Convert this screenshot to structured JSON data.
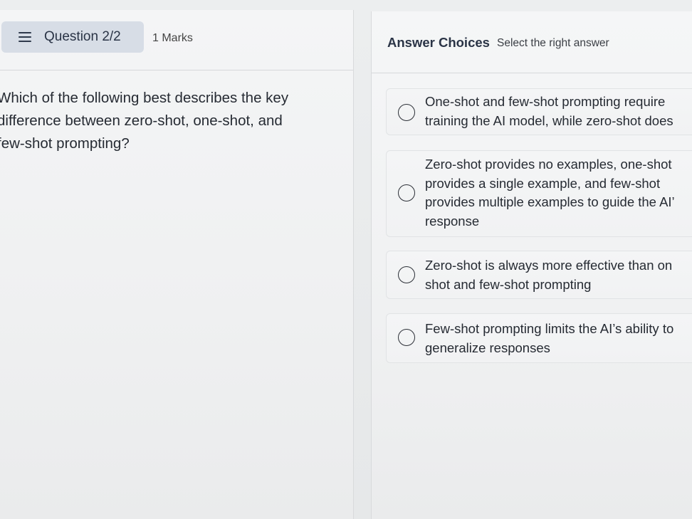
{
  "question_header": {
    "label": "Question 2/2",
    "marks": "1 Marks"
  },
  "question": {
    "lines": [
      "Which of the following best describes the key",
      "difference between zero-shot, one-shot, and",
      "few-shot prompting?"
    ]
  },
  "answers_header": {
    "title": "Answer Choices",
    "subtitle": "Select the right answer"
  },
  "choices": [
    {
      "lines": [
        "One-shot and few-shot prompting require",
        "training the AI model, while zero-shot does"
      ]
    },
    {
      "lines": [
        "Zero-shot provides no examples, one-shot",
        "provides a single example, and few-shot",
        "provides multiple examples to guide the AI’",
        "response"
      ]
    },
    {
      "lines": [
        "Zero-shot is always more effective than on",
        "shot and few-shot prompting"
      ]
    },
    {
      "lines": [
        "Few-shot prompting limits the AI’s ability to",
        "generalize responses"
      ]
    }
  ],
  "colors": {
    "chip_background": "#d7dde6",
    "chip_text": "#2a3446"
  },
  "icons": {
    "menu": "hamburger-menu-icon",
    "radio": "radio-unselected-icon"
  }
}
